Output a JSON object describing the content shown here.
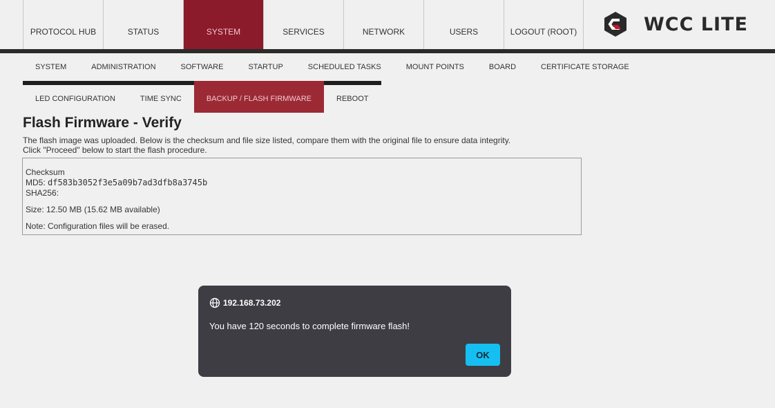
{
  "watermark": "WCC LITE",
  "menu": [
    {
      "label": "PROTOCOL HUB"
    },
    {
      "label": "STATUS"
    },
    {
      "label": "SYSTEM"
    },
    {
      "label": "SERVICES"
    },
    {
      "label": "NETWORK"
    },
    {
      "label": "USERS"
    },
    {
      "label": "LOGOUT (ROOT)"
    }
  ],
  "active_menu": "SYSTEM",
  "logo_text": "WCC LITE",
  "subnav_row1": [
    {
      "label": "SYSTEM"
    },
    {
      "label": "ADMINISTRATION"
    },
    {
      "label": "SOFTWARE"
    },
    {
      "label": "STARTUP"
    },
    {
      "label": "SCHEDULED TASKS"
    },
    {
      "label": "MOUNT POINTS"
    },
    {
      "label": "BOARD"
    },
    {
      "label": "CERTIFICATE STORAGE"
    }
  ],
  "subnav_row2": [
    {
      "label": "LED CONFIGURATION"
    },
    {
      "label": "TIME SYNC"
    },
    {
      "label": "BACKUP / FLASH FIRMWARE"
    },
    {
      "label": "REBOOT"
    }
  ],
  "active_subtab": "BACKUP / FLASH FIRMWARE",
  "page": {
    "title": "Flash Firmware - Verify",
    "desc_line1": "The flash image was uploaded. Below is the checksum and file size listed, compare them with the original file to ensure data integrity.",
    "desc_line2": "Click \"Proceed\" below to start the flash procedure."
  },
  "info": {
    "checksum_label": "Checksum",
    "md5_label": "MD5:",
    "md5_value": "df583b3052f3e5a09b7ad3dfb8a3745b",
    "sha256_label": "SHA256:",
    "size_text": "Size: 12.50 MB (15.62 MB available)",
    "note_text": "Note: Configuration files will be erased."
  },
  "dialog": {
    "host": "192.168.73.202",
    "message": "You have 120 seconds to complete firmware flash!",
    "ok_label": "OK"
  },
  "colors": {
    "accent_dark_red": "#8b1a2b",
    "dialog_bg": "#3e3d44",
    "ok_button": "#15bff1"
  }
}
